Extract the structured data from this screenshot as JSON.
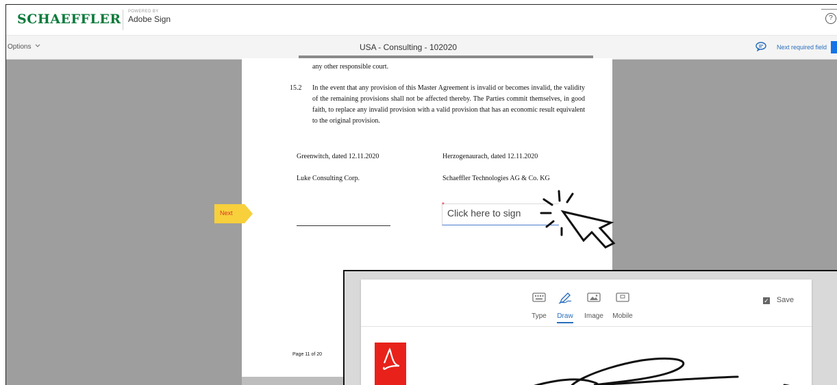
{
  "brand": {
    "logo": "SCHAEFFLER",
    "powered_by": "POWERED BY",
    "product": "Adobe Sign"
  },
  "toolbar": {
    "options_label": "Options",
    "doc_title": "USA - Consulting - 102020",
    "next_required": "Next required field"
  },
  "help_icon": "?",
  "document": {
    "clause_14_tail": "any other responsible court.",
    "clause_15_2_num": "15.2",
    "clause_15_2_text": "In the event that any provision of this Master Agreement is invalid or becomes invalid, the validity of the remaining provisions shall not be affected thereby. The Parties commit themselves, in good faith, to replace any invalid provision with a valid provision that has an economic result equivalent to the original provision.",
    "left_place_date": "Greenwitch, dated 12.11.2020",
    "right_place_date": "Herzogenaurach, dated 12.11.2020",
    "left_party": "Luke Consulting Corp.",
    "right_party": "Schaeffler Technologies AG & Co. KG",
    "sign_field_required": "*",
    "sign_field_text": "Click here to sign",
    "page_number": "Page 11 of 20"
  },
  "next_tag": "Next",
  "signature_modal": {
    "tabs": [
      {
        "label": "Type",
        "icon": "keyboard-icon"
      },
      {
        "label": "Draw",
        "icon": "pen-icon"
      },
      {
        "label": "Image",
        "icon": "image-icon"
      },
      {
        "label": "Mobile",
        "icon": "mobile-icon"
      }
    ],
    "active_tab": "Draw",
    "save_label": "Save",
    "save_checked": true
  },
  "colors": {
    "brand_green": "#0b7a3b",
    "accent_blue": "#2a6ebb",
    "next_tag_yellow": "#f7d03c",
    "pdf_red": "#e8211b"
  }
}
